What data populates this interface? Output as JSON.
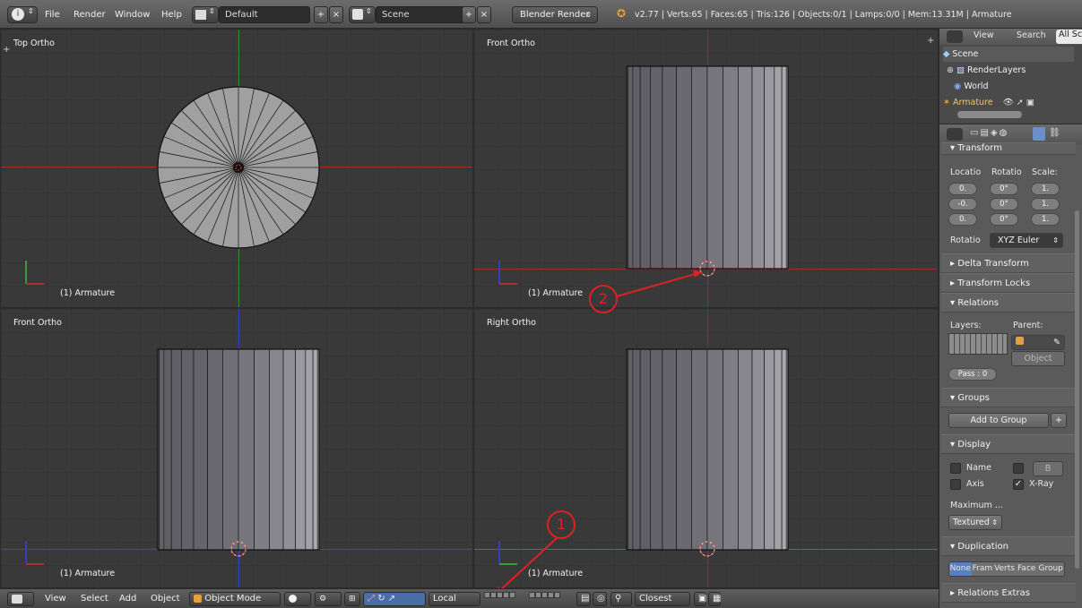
{
  "header": {
    "menus": [
      "File",
      "Render",
      "Window",
      "Help"
    ],
    "layout": "Default",
    "scene": "Scene",
    "engine": "Blender Render",
    "stats": "v2.77 | Verts:65 | Faces:65 | Tris:126 | Objects:0/1 | Lamps:0/0 | Mem:13.31M | Armature"
  },
  "viewports": [
    {
      "title": "Top Ortho",
      "object": "(1) Armature"
    },
    {
      "title": "Front Ortho",
      "object": "(1) Armature"
    },
    {
      "title": "Front Ortho",
      "object": "(1) Armature"
    },
    {
      "title": "Right Ortho",
      "object": "(1) Armature"
    }
  ],
  "footer": {
    "menus": [
      "View",
      "Select",
      "Add",
      "Object"
    ],
    "mode": "Object Mode",
    "orientation": "Local",
    "snap": "Closest"
  },
  "outliner": {
    "view": "View",
    "search": "Search",
    "all_scenes": "All Sc",
    "items": [
      "Scene",
      "RenderLayers",
      "World",
      "Armature"
    ]
  },
  "properties": {
    "transform": "Transform",
    "col_location": "Locatio",
    "col_rotation": "Rotatio",
    "col_scale": "Scale:",
    "loc": [
      "0.",
      "-0.",
      "0."
    ],
    "rot": [
      "0°",
      "0°",
      "0°"
    ],
    "scale": [
      "1.",
      "1.",
      "1."
    ],
    "rotation_mode_label": "Rotatio",
    "rotation_mode": "XYZ Euler",
    "delta_transform": "Delta Transform",
    "transform_locks": "Transform Locks",
    "relations": "Relations",
    "layers_label": "Layers:",
    "parent_label": "Parent:",
    "parent_type": "Object",
    "pass": "Pass : 0",
    "groups": "Groups",
    "add_to_group": "Add to Group",
    "display": "Display",
    "name": "Name",
    "axis": "Axis",
    "xray": "X-Ray",
    "bounds": "B",
    "maximum": "Maximum ...",
    "draw_type": "Textured",
    "duplication": "Duplication",
    "dup_options": [
      "None",
      "Fram",
      "Verts",
      "Face",
      "Group"
    ],
    "relations_extras": "Relations Extras"
  },
  "annotations": [
    "1",
    "2"
  ],
  "colors": {
    "x_axis": "#b03030",
    "y_axis": "#3a9a3a",
    "z_axis": "#3040c8",
    "mesh": "#9a9a9a",
    "annotation": "#e02020"
  }
}
